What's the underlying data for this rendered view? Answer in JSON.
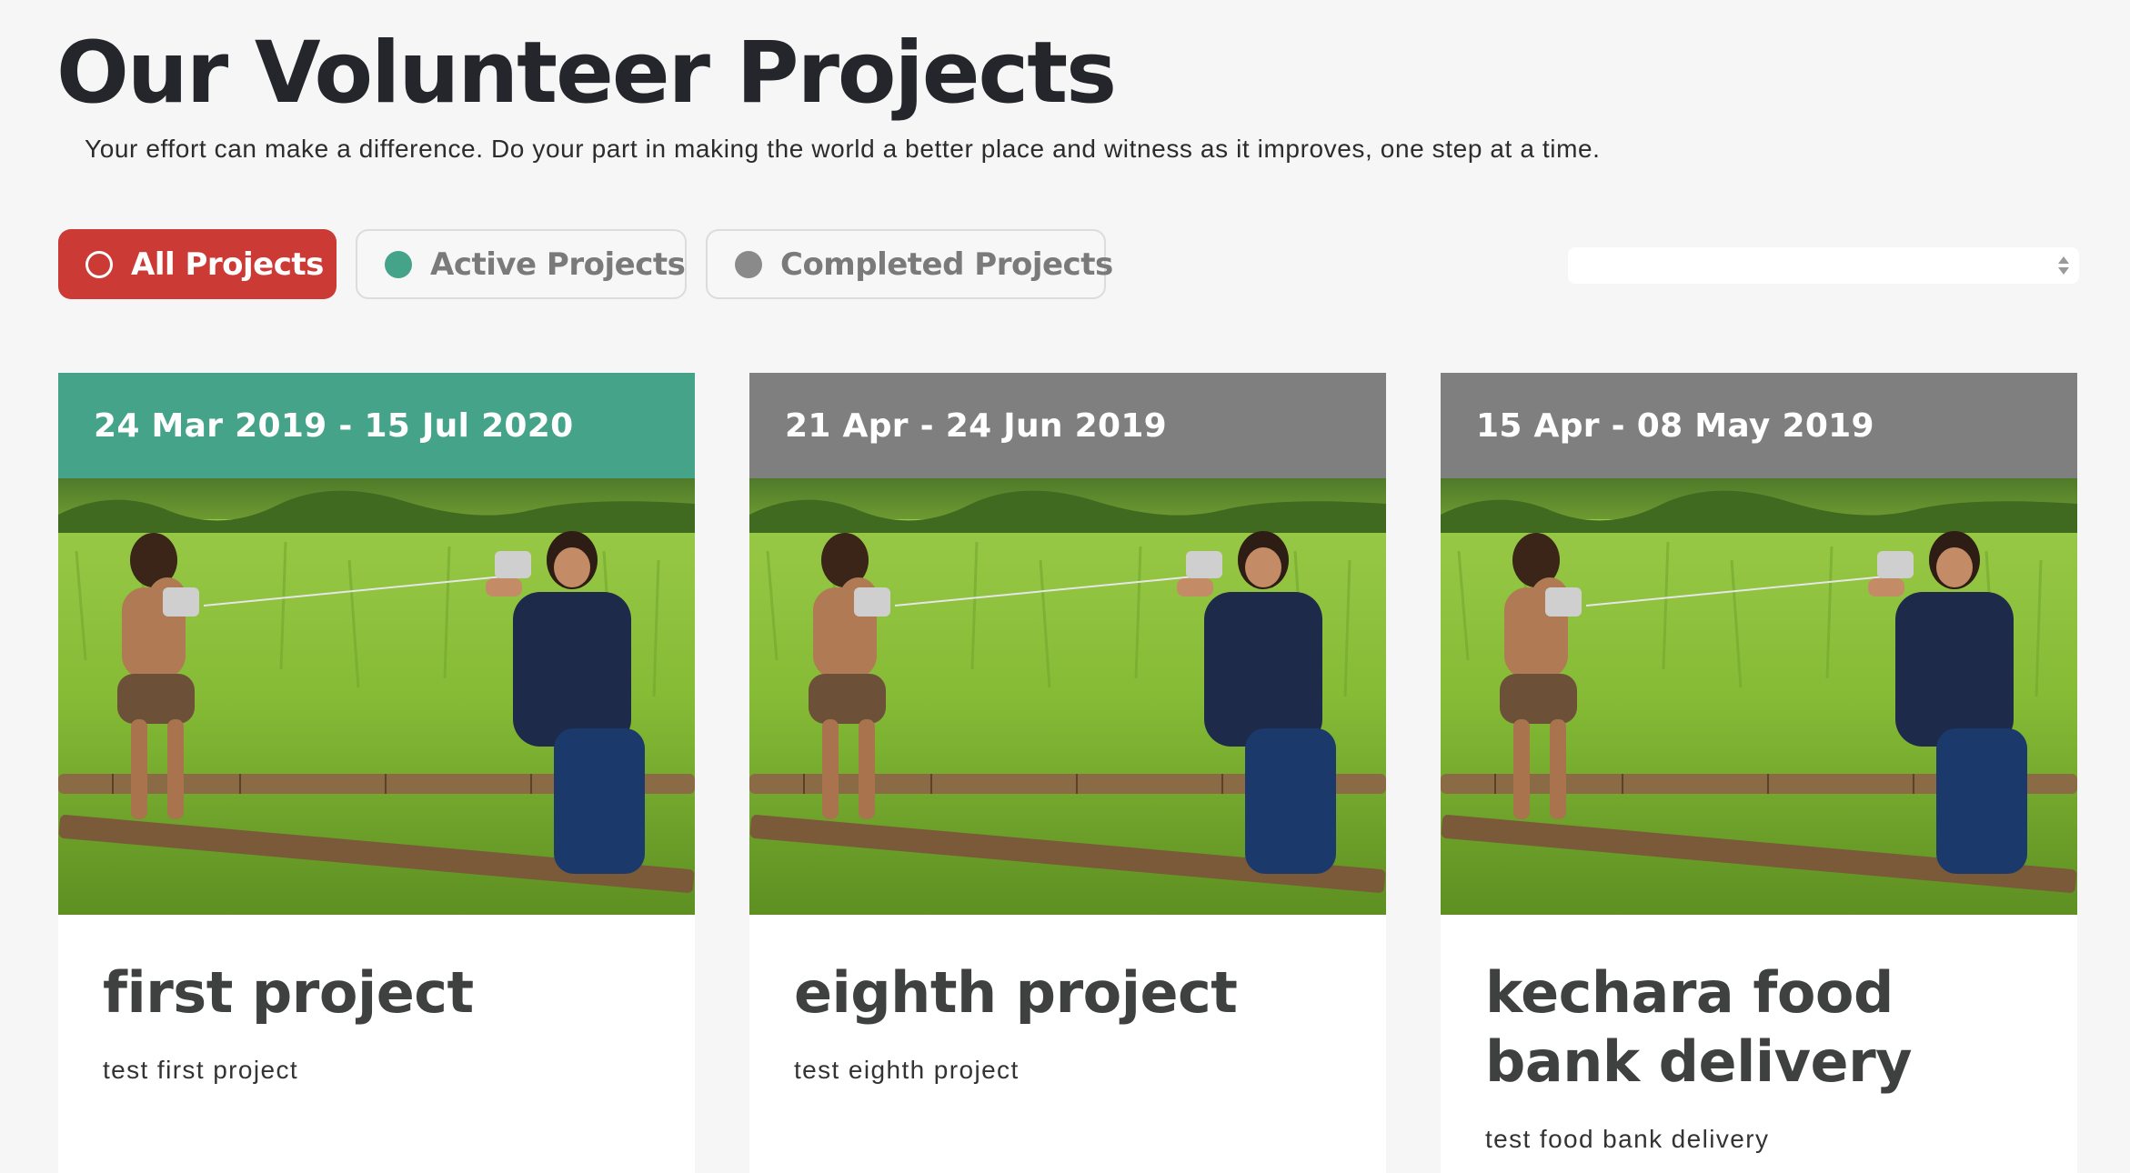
{
  "header": {
    "title": "Our Volunteer Projects",
    "subtitle": "Your effort can make a difference. Do your part in making the world a better place and witness as it improves, one step at a time."
  },
  "filters": {
    "all": "All Projects",
    "active": "Active Projects",
    "completed": "Completed Projects"
  },
  "sort": {
    "value": ""
  },
  "colors": {
    "accent_red": "#cc3a36",
    "active_green": "#45a38a",
    "completed_gray": "#7f7f7f"
  },
  "projects": [
    {
      "status": "active",
      "dates": "24 Mar 2019 - 15 Jul 2020",
      "title": "first project",
      "description": "test first project"
    },
    {
      "status": "completed",
      "dates": "21 Apr - 24 Jun 2019",
      "title": "eighth project",
      "description": "test eighth project"
    },
    {
      "status": "completed",
      "dates": "15 Apr - 08 May 2019",
      "title": "kechara food bank delivery",
      "description": "test food bank delivery"
    }
  ]
}
